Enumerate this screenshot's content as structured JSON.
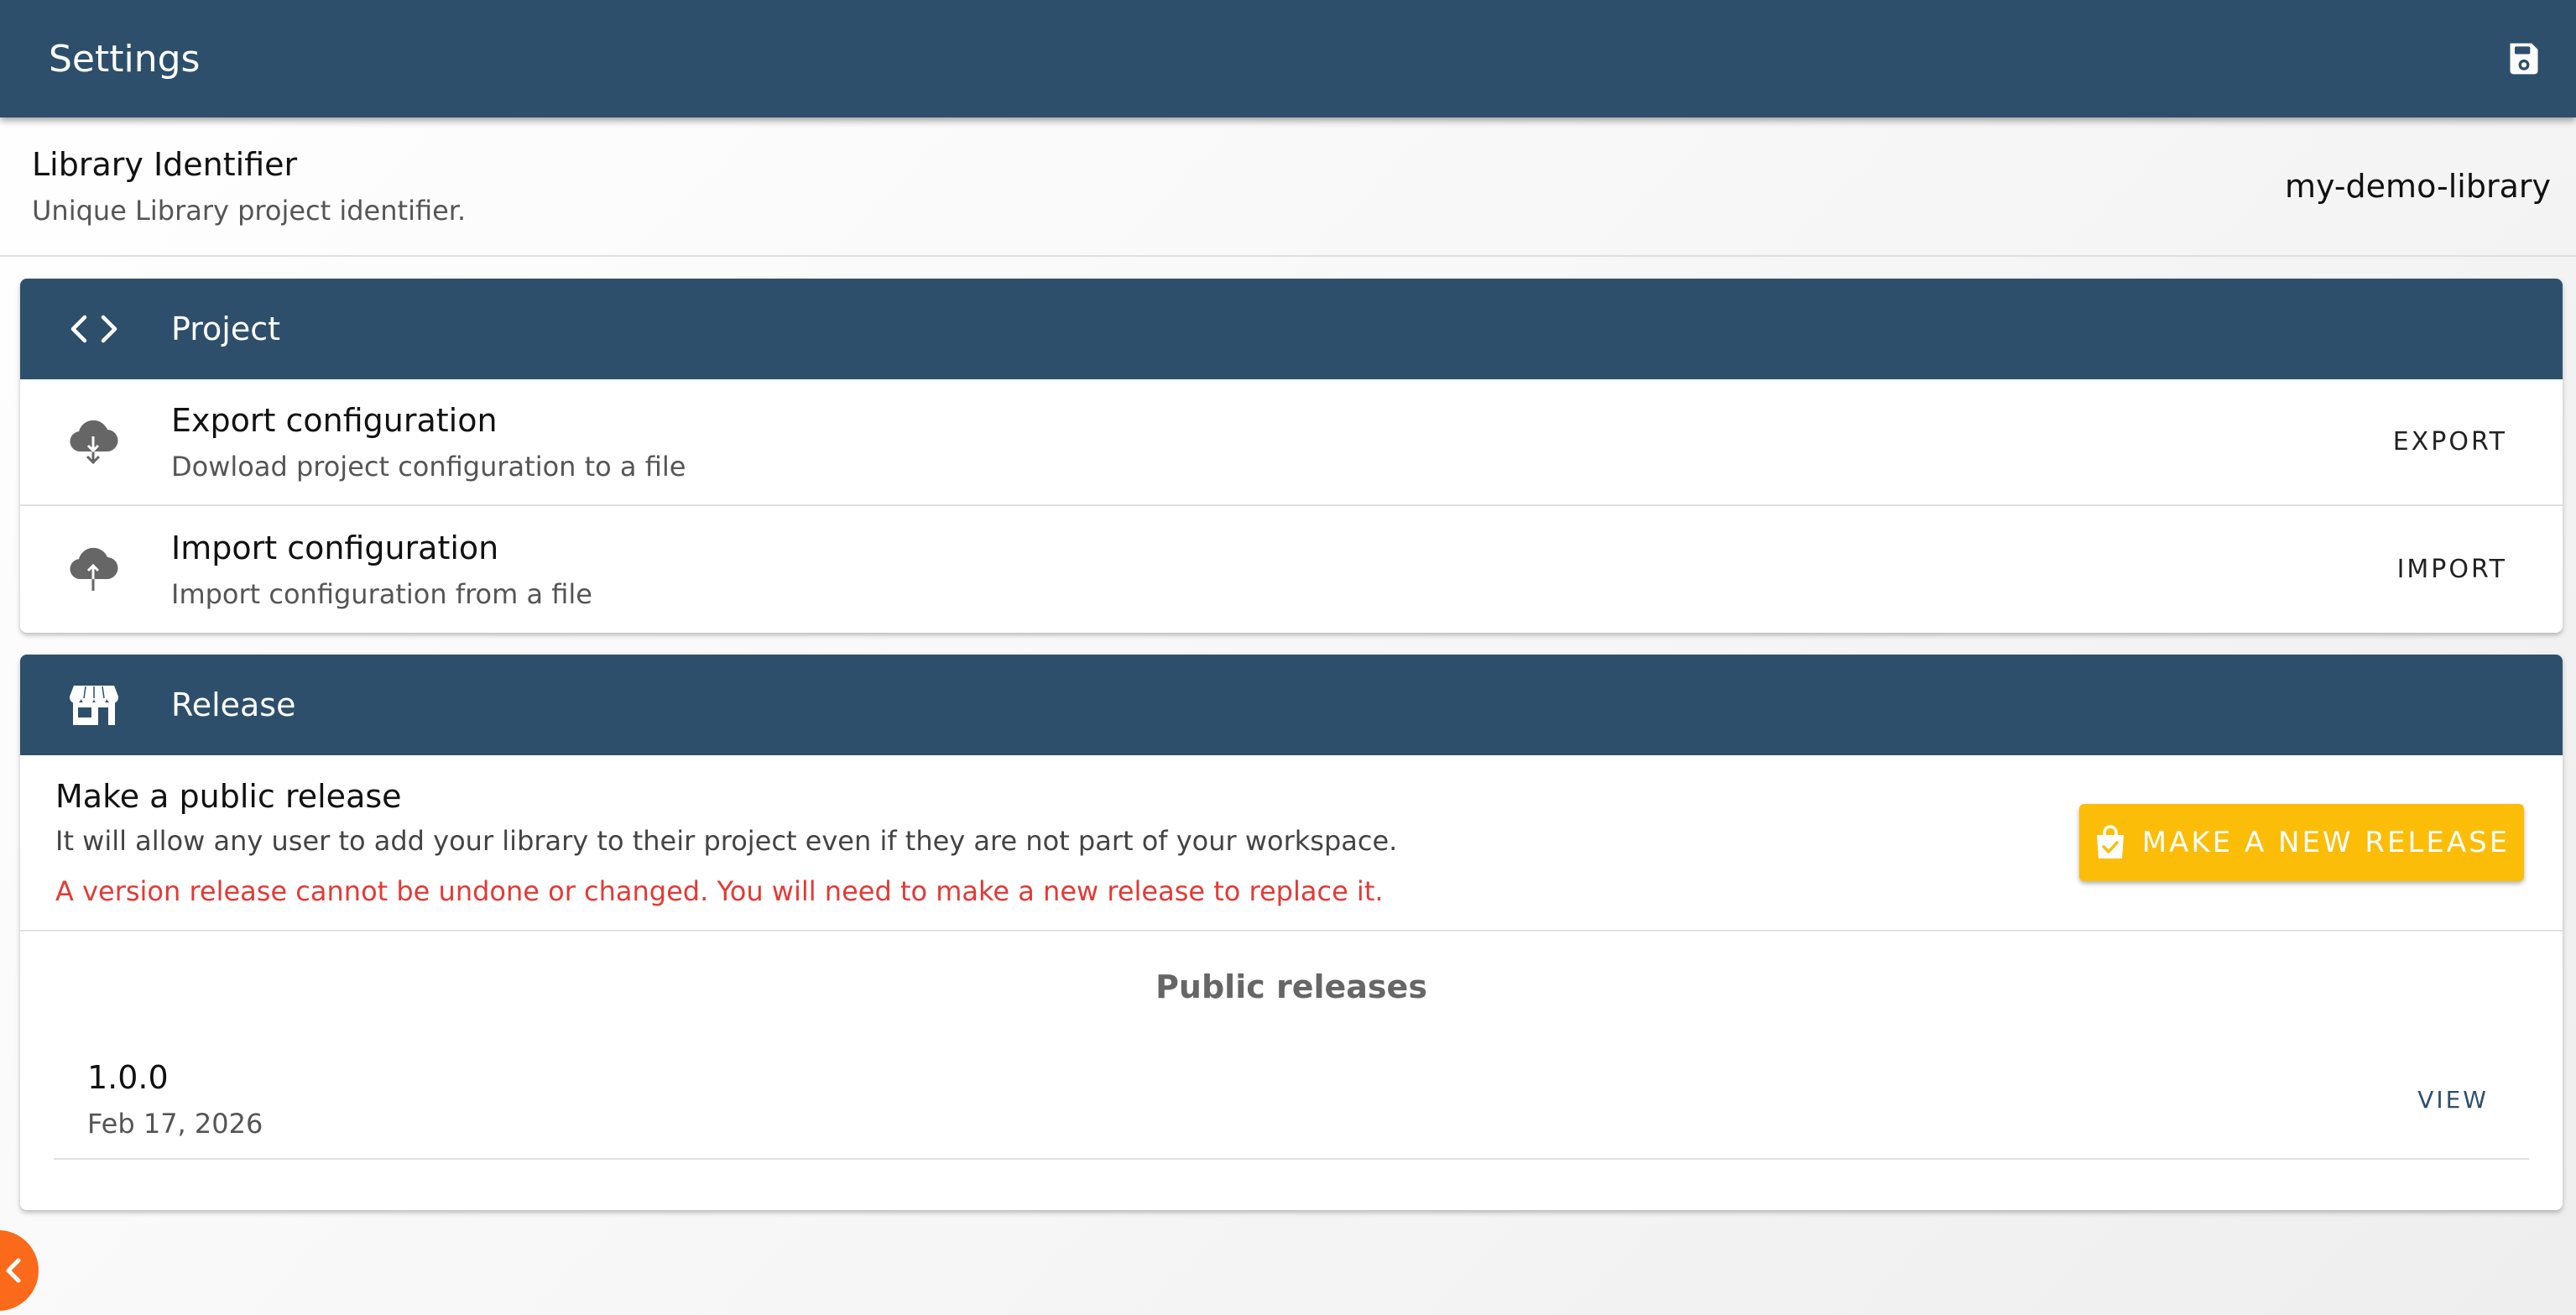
{
  "header": {
    "title": "Settings",
    "save_icon": "save-icon"
  },
  "library": {
    "label": "Library Identifier",
    "description": "Unique Library project identifier.",
    "value": "my-demo-library"
  },
  "project": {
    "title": "Project",
    "icon": "code-icon",
    "items": [
      {
        "title": "Export configuration",
        "description": "Dowload project configuration to a file",
        "action": "EXPORT",
        "icon": "cloud-download-icon"
      },
      {
        "title": "Import configuration",
        "description": "Import configuration from a file",
        "action": "IMPORT",
        "icon": "cloud-upload-icon"
      }
    ]
  },
  "release": {
    "title": "Release",
    "icon": "store-icon",
    "heading": "Make a public release",
    "description": "It will allow any user to add your library to their project even if they are not part of your workspace.",
    "warning": "A version release cannot be undone or changed. You will need to make a new release to replace it.",
    "button_label": "MAKE A NEW RELEASE",
    "button_icon": "shopping-bag-check-icon",
    "public_releases_title": "Public releases",
    "releases": [
      {
        "version": "1.0.0",
        "date": "Feb 17, 2026",
        "action": "VIEW"
      }
    ]
  },
  "colors": {
    "primary": "#2d4f6b",
    "accent": "#fbbd08",
    "warning": "#e53935",
    "fab": "#fb6a1a"
  }
}
